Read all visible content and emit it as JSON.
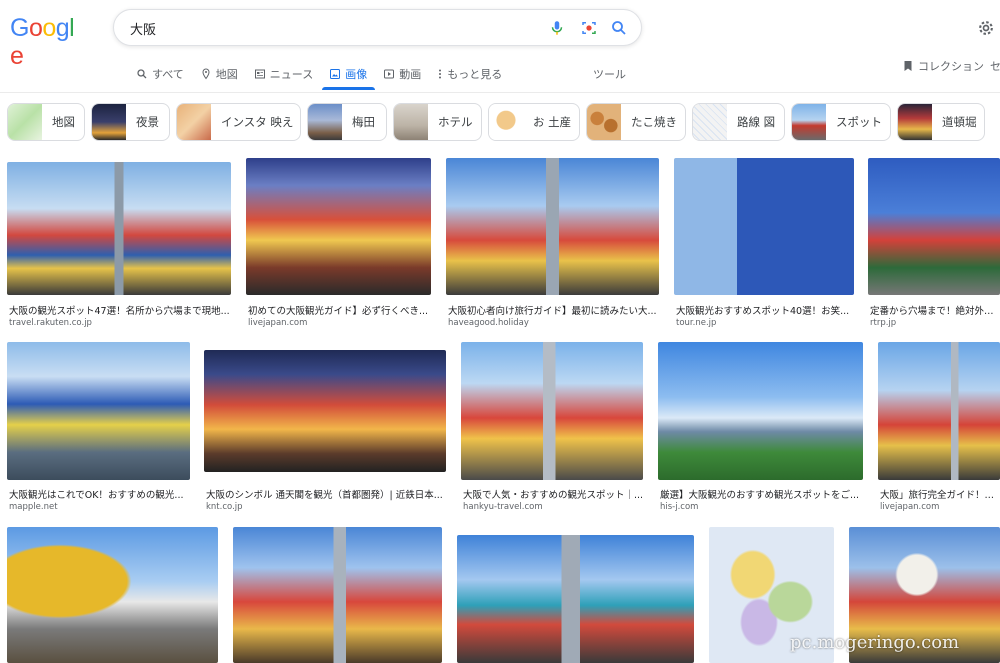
{
  "logo": {
    "text": "Google"
  },
  "search": {
    "query": "大阪"
  },
  "nav": {
    "tabs": [
      {
        "label": "すべて",
        "icon": "search-icon"
      },
      {
        "label": "地図",
        "icon": "map-pin-icon"
      },
      {
        "label": "ニュース",
        "icon": "news-icon"
      },
      {
        "label": "画像",
        "icon": "image-icon",
        "active": true
      },
      {
        "label": "動画",
        "icon": "play-icon"
      },
      {
        "label": "もっと見る",
        "icon": "more-icon"
      }
    ],
    "tools": "ツール",
    "collection": "コレクション",
    "se": "セ"
  },
  "chips": [
    {
      "label": "地図"
    },
    {
      "label": "夜景"
    },
    {
      "label": "インスタ 映え"
    },
    {
      "label": "梅田"
    },
    {
      "label": "ホテル"
    },
    {
      "label": "お 土産"
    },
    {
      "label": "たこ焼き"
    },
    {
      "label": "路線 図"
    },
    {
      "label": "スポット"
    },
    {
      "label": "道頓堀"
    }
  ],
  "results": [
    {
      "caption": "大阪の観光スポット47選！名所から穴場まで現地...",
      "source": "travel.rakuten.co.jp"
    },
    {
      "caption": "初めての大阪観光ガイド】必ず行くべき...",
      "source": "livejapan.com"
    },
    {
      "caption": "大阪初心者向け旅行ガイド】最初に読みたい大...",
      "source": "haveagood.holiday"
    },
    {
      "caption": "大阪観光おすすめスポット40選！お笑...",
      "source": "tour.ne.jp"
    },
    {
      "caption": "定番から穴場まで！絶対外せな",
      "source": "rtrp.jp"
    },
    {
      "caption": "大阪観光はこれでOK！おすすめの観光...",
      "source": "mapple.net"
    },
    {
      "caption": "大阪のシンボル 通天閣を観光（首都圏発）| 近鉄日本...",
      "source": "knt.co.jp"
    },
    {
      "caption": "大阪で人気・おすすめの観光スポット｜...",
      "source": "hankyu-travel.com"
    },
    {
      "caption": "厳選】大阪観光のおすすめ観光スポットをご...",
      "source": "his-j.com"
    },
    {
      "caption": "大阪」旅行完全ガイド！交通",
      "source": "livejapan.com"
    }
  ],
  "watermark": "pc.mogeringo.com",
  "colors": {
    "accent": "#1a73e8",
    "blue": "#4285F4",
    "red": "#EA4335",
    "yellow": "#FBBC05",
    "green": "#34A853"
  }
}
